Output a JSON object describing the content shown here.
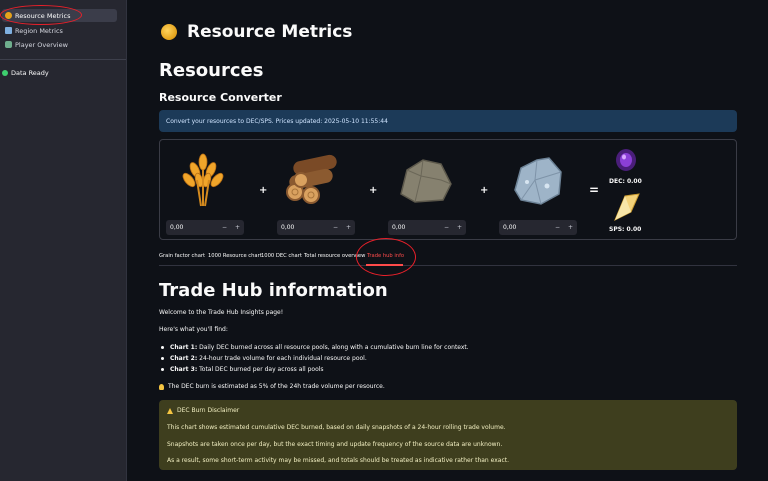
{
  "sidebar": {
    "items": [
      {
        "label": "Resource Metrics",
        "icon": "coin-icon",
        "active": true
      },
      {
        "label": "Region Metrics",
        "icon": "map-icon",
        "active": false
      },
      {
        "label": "Player Overview",
        "icon": "player-icon",
        "active": false
      }
    ],
    "status": "Data Ready"
  },
  "page": {
    "title": "Resource Metrics",
    "section": "Resources",
    "subsection": "Resource Converter",
    "info": "Convert your resources to DEC/SPS. Prices updated: 2025-05-10 11:55:44"
  },
  "converter": {
    "resources": [
      {
        "name": "grain",
        "value": "0,00"
      },
      {
        "name": "wood",
        "value": "0,00"
      },
      {
        "name": "stone",
        "value": "0,00"
      },
      {
        "name": "iron",
        "value": "0,00"
      }
    ],
    "minus": "−",
    "plus": "+",
    "equals": "=",
    "dec": "DEC: 0.00",
    "sps": "SPS: 0.00"
  },
  "tabs": [
    "Grain factor chart",
    "1000 Resource chart",
    "1000 DEC chart",
    "Total resource overview",
    "Trade hub info"
  ],
  "active_tab": "Trade hub info",
  "trade_hub": {
    "heading": "Trade Hub information",
    "welcome": "Welcome to the Trade Hub Insights page!",
    "find": "Here's what you'll find:",
    "bullets": [
      {
        "bold": "Chart 1:",
        "text": " Daily DEC burned across all resource pools, along with a cumulative burn line for context."
      },
      {
        "bold": "Chart 2:",
        "text": " 24-hour trade volume for each individual resource pool."
      },
      {
        "bold": "Chart 3:",
        "text": " Total DEC burned per day across all pools"
      }
    ],
    "note": "The DEC burn is estimated as 5% of the 24h trade volume per resource."
  },
  "disclaimer": {
    "title": "DEC Burn Disclaimer",
    "lines": [
      "This chart shows estimated cumulative DEC burned, based on daily snapshots of a 24-hour rolling trade volume.",
      "Snapshots are taken once per day, but the exact timing and update frequency of the source data are unknown.",
      "As a result, some short-term activity may be missed, and totals should be treated as indicative rather than exact."
    ]
  },
  "colors": {
    "accent": "#ff4b4b",
    "info_bg": "#1c3a58",
    "warn_bg": "#3e3e1e",
    "annotation": "#e8202a"
  }
}
